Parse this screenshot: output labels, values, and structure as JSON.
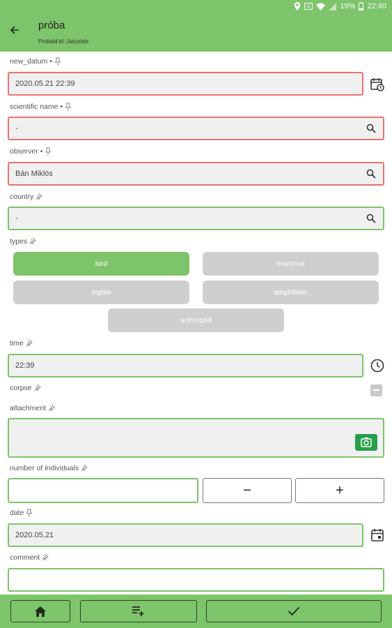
{
  "status": {
    "battery": "19%",
    "time": "22:40",
    "icons": [
      "location-icon",
      "nfc-icon",
      "wifi-icon",
      "signal-icon",
      "battery-icon"
    ]
  },
  "appbar": {
    "title": "próba",
    "subtitle": "Próbáld ki! Játszótér"
  },
  "form": {
    "new_datum": {
      "label": "new_datum •",
      "value": "2020.05.21 22:39"
    },
    "scientific_name": {
      "label": "scientific name •",
      "value": "-"
    },
    "observer": {
      "label": "observer •",
      "value": "Bán Miklós"
    },
    "country": {
      "label": "country",
      "value": "-"
    },
    "types": {
      "label": "types",
      "options": [
        "bird",
        "mammal",
        "reptile",
        "amphibian",
        "arthropod"
      ],
      "selected": "bird"
    },
    "time": {
      "label": "time",
      "value": "22:39"
    },
    "corpse": {
      "label": "corpse"
    },
    "attachment": {
      "label": "attachment"
    },
    "number_of_individuals": {
      "label": "number of individuals",
      "value": "",
      "minus": "−",
      "plus": "+"
    },
    "date": {
      "label": "date",
      "value": "2020.05.21"
    },
    "comment": {
      "label": "comment",
      "value": ""
    }
  },
  "colors": {
    "accent": "#7dc46a",
    "required_border": "#e57373",
    "camera": "#27a04a",
    "inactive_chip": "#cfcfcf"
  }
}
